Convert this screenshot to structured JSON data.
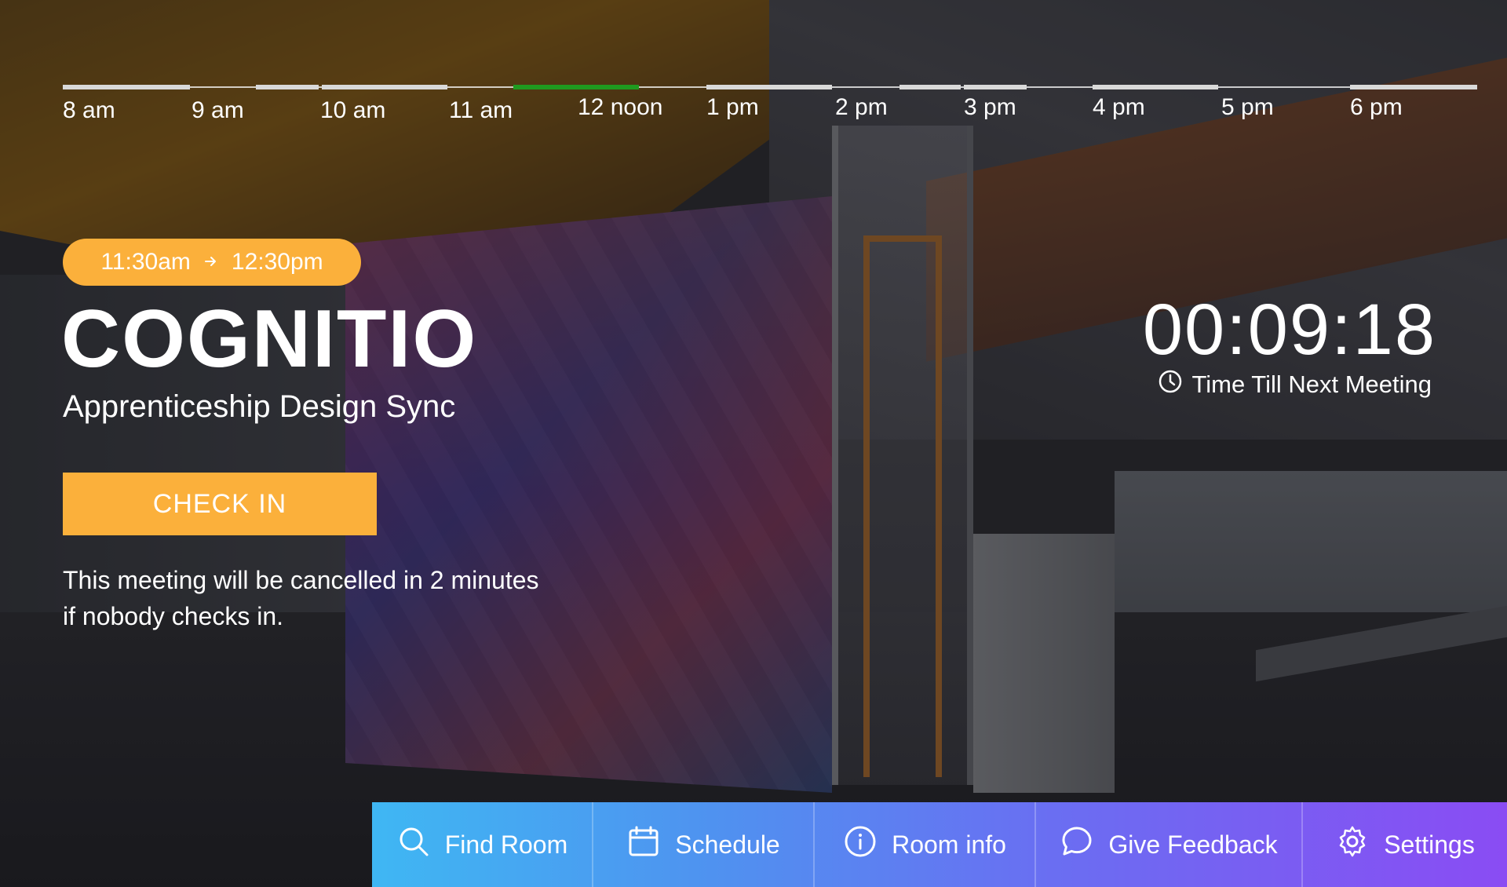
{
  "timeline": {
    "labels": [
      "8 am",
      "9 am",
      "10 am",
      "11 am",
      "12 noon",
      "1 pm",
      "2 pm",
      "3 pm",
      "4 pm",
      "5 pm",
      "6 pm"
    ],
    "colors": {
      "booked": "#d9d9d9",
      "current": "#1f9a1f",
      "free": "#ffffff"
    }
  },
  "meeting": {
    "start": "11:30am",
    "end": "12:30pm",
    "room_name": "COGNITIO",
    "title": "Apprenticeship Design Sync",
    "checkin_label": "CHECK IN",
    "cancel_note_line1": "This meeting will be cancelled in 2 minutes",
    "cancel_note_line2": "if nobody checks in."
  },
  "countdown": {
    "value": "00:09:18",
    "label": "Time Till Next Meeting",
    "icon": "clock-icon"
  },
  "nav": {
    "find_room": "Find Room",
    "schedule": "Schedule",
    "room_info": "Room info",
    "give_feedback": "Give Feedback",
    "settings": "Settings"
  },
  "colors": {
    "accent": "#fbb03b",
    "nav_start": "#3fb7f3",
    "nav_end": "#8a4cf3"
  }
}
